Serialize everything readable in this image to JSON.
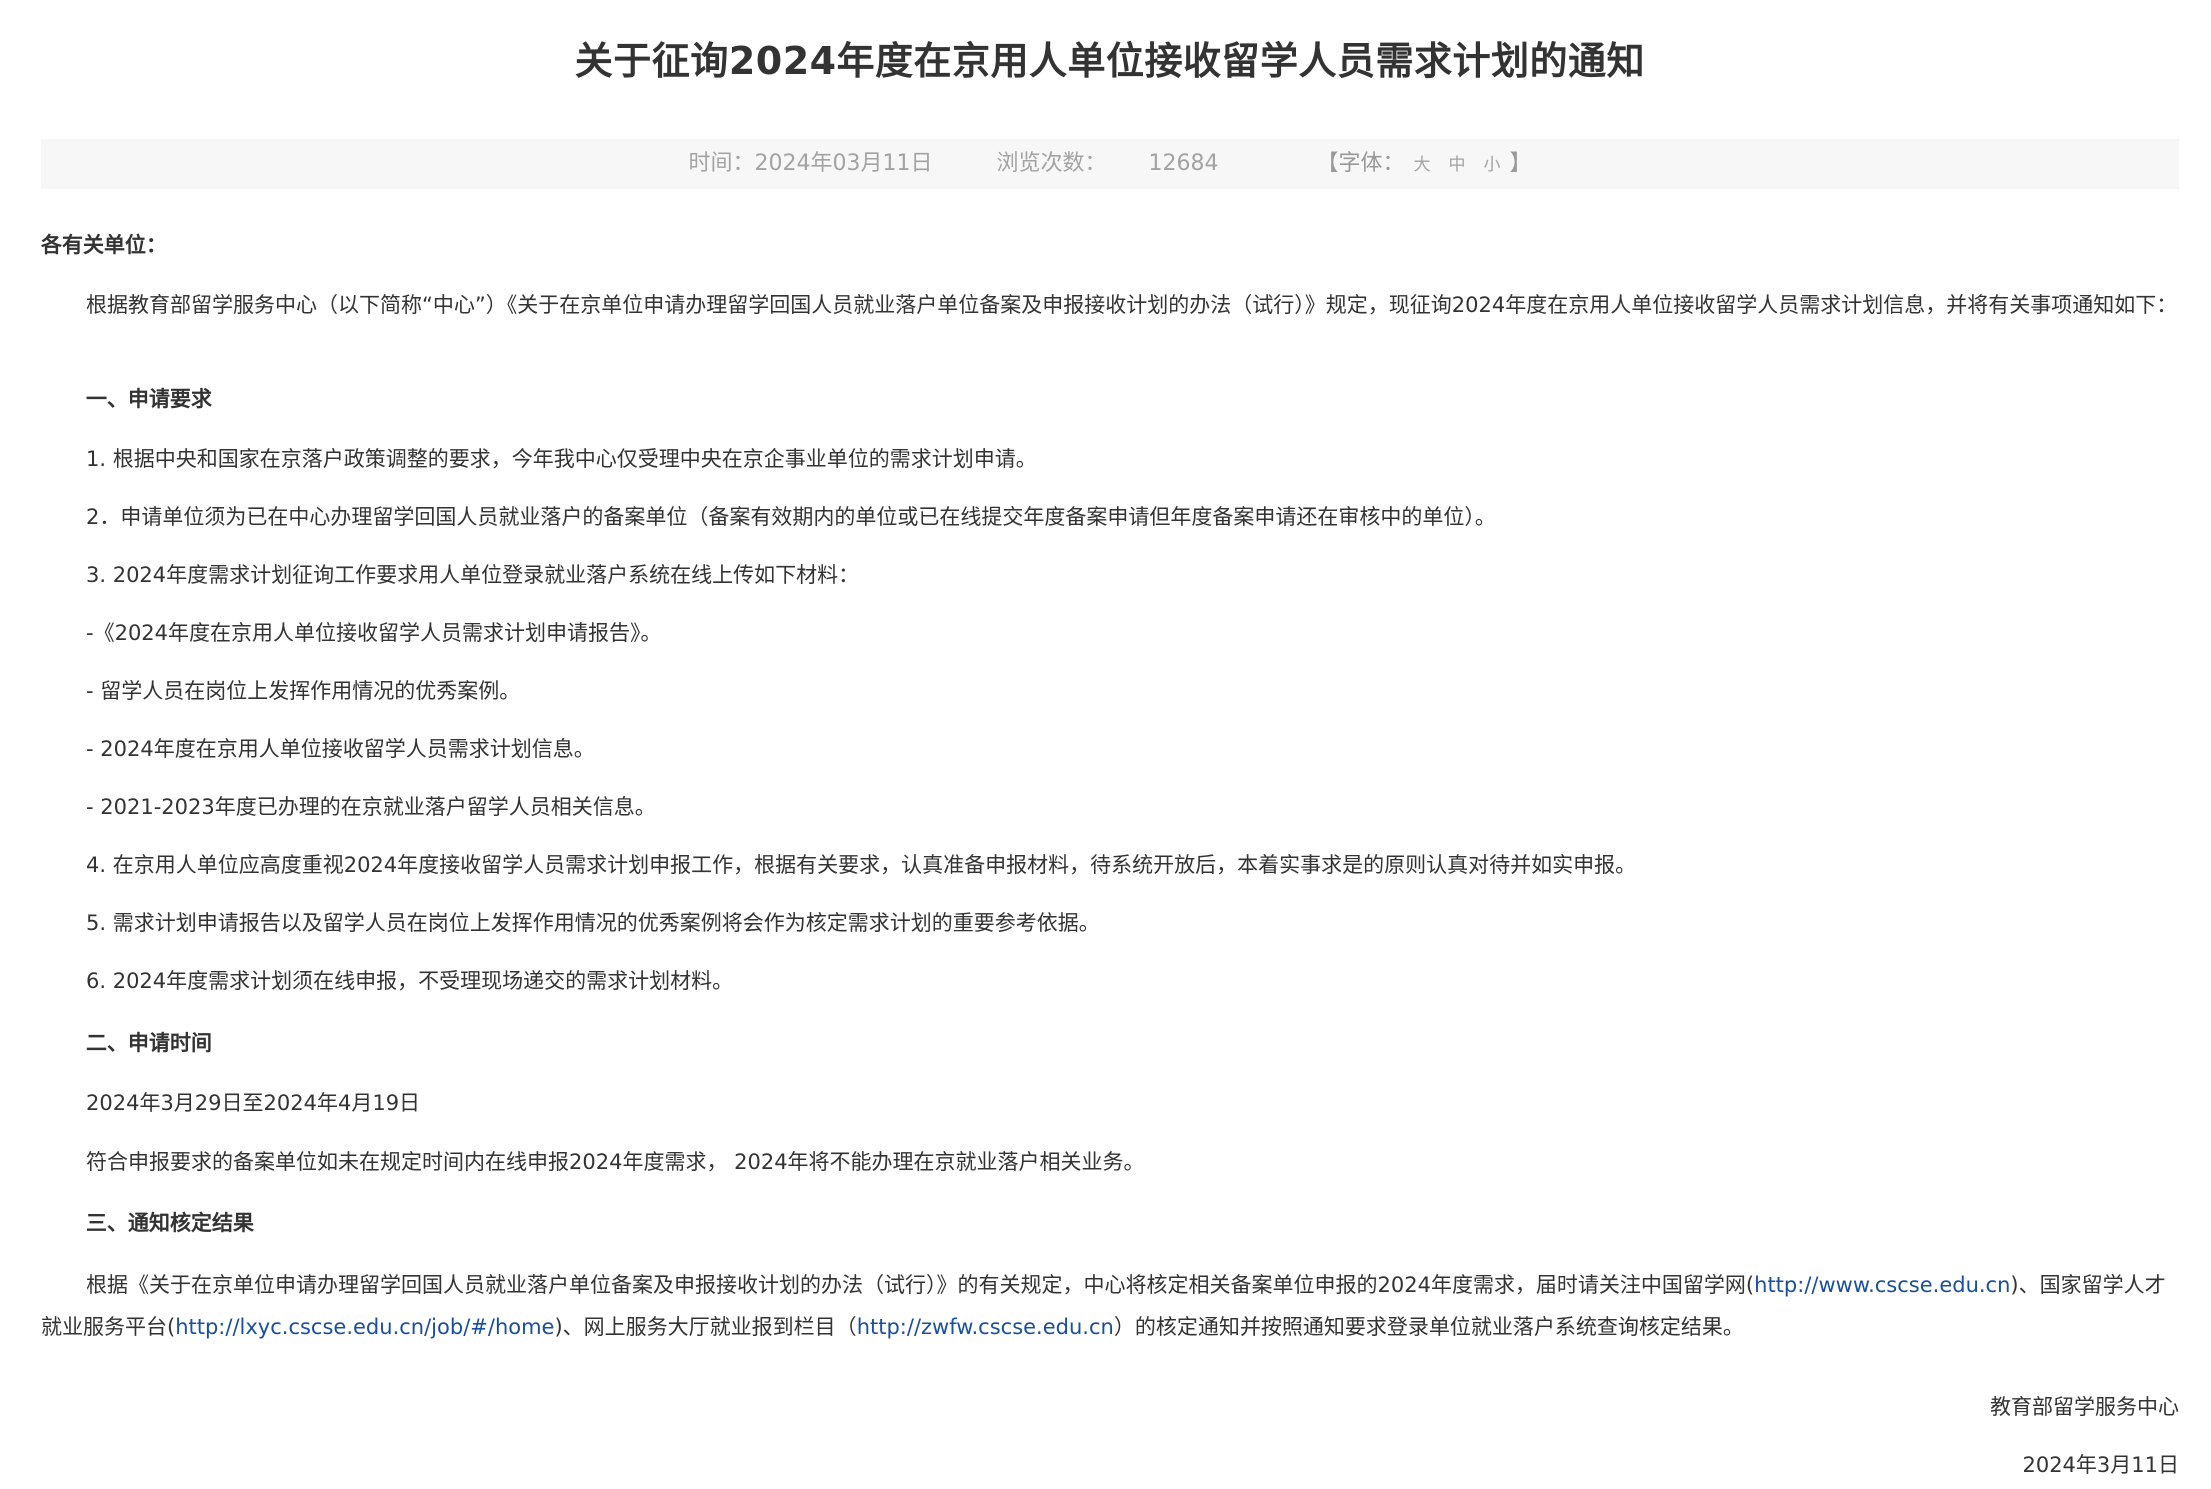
{
  "title": "关于征询2024年度在京用人单位接收留学人员需求计划的通知",
  "meta": {
    "time_label": "时间：2024年03月11日",
    "views_label": "浏览次数：",
    "views_count": "12684",
    "font_label": "【字体：",
    "font_large": "大",
    "font_medium": "中",
    "font_small": "小",
    "font_close": "】"
  },
  "body": {
    "salutation": "各有关单位：",
    "intro": "根据教育部留学服务中心（以下简称“中心”）《关于在京单位申请办理留学回国人员就业落户单位备案及申报接收计划的办法（试行）》规定，现征询2024年度在京用人单位接收留学人员需求计划信息，并将有关事项通知如下：",
    "section1_title": "一、申请要求",
    "section1_items": [
      "1. 根据中央和国家在京落户政策调整的要求，今年我中心仅受理中央在京企事业单位的需求计划申请。",
      "2．申请单位须为已在中心办理留学回国人员就业落户的备案单位（备案有效期内的单位或已在线提交年度备案申请但年度备案申请还在审核中的单位）。",
      "3. 2024年度需求计划征询工作要求用人单位登录就业落户系统在线上传如下材料：",
      "-《2024年度在京用人单位接收留学人员需求计划申请报告》。",
      "- 留学人员在岗位上发挥作用情况的优秀案例。",
      "- 2024年度在京用人单位接收留学人员需求计划信息。",
      "- 2021-2023年度已办理的在京就业落户留学人员相关信息。",
      "4. 在京用人单位应高度重视2024年度接收留学人员需求计划申报工作，根据有关要求，认真准备申报材料，待系统开放后，本着实事求是的原则认真对待并如实申报。",
      "5. 需求计划申请报告以及留学人员在岗位上发挥作用情况的优秀案例将会作为核定需求计划的重要参考依据。",
      "6.  2024年度需求计划须在线申报，不受理现场递交的需求计划材料。"
    ],
    "section2_title": "二、申请时间",
    "section2_date": "2024年3月29日至2024年4月19日",
    "section2_note": "符合申报要求的备案单位如未在规定时间内在线申报2024年度需求， 2024年将不能办理在京就业落户相关业务。",
    "section3_title": "三、通知核定结果",
    "section3_text_a": "根据《关于在京单位申请办理留学回国人员就业落户单位备案及申报接收计划的办法（试行）》的有关规定，中心将核定相关备案单位申报的2024年度需求，届时请关注中国留学网(",
    "link1": "http://www.cscse.edu.cn",
    "section3_text_b": ")、国家留学人才就业服务平台(",
    "link2": "http://lxyc.cscse.edu.cn/job/#/home",
    "section3_text_c": ")、网上服务大厅就业报到栏目（",
    "link3": "http://zwfw.cscse.edu.cn",
    "section3_text_d": "）的核定通知并按照通知要求登录单位就业落户系统查询核定结果。",
    "signature": "教育部留学服务中心",
    "sign_date": "2024年3月11日"
  },
  "colors": {
    "text": "#333333",
    "meta_text": "#a3a3a3",
    "meta_bg": "#f7f7f7",
    "link": "#1a4fa0"
  }
}
